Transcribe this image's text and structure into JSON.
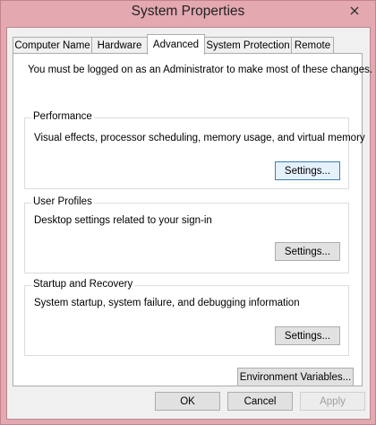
{
  "window": {
    "title": "System Properties"
  },
  "tabs": [
    {
      "label": "Computer Name"
    },
    {
      "label": "Hardware"
    },
    {
      "label": "Advanced"
    },
    {
      "label": "System Protection"
    },
    {
      "label": "Remote"
    }
  ],
  "active_tab": "Advanced",
  "notice": "You must be logged on as an Administrator to make most of these changes.",
  "groups": {
    "performance": {
      "title": "Performance",
      "description": "Visual effects, processor scheduling, memory usage, and virtual memory",
      "button": "Settings..."
    },
    "user_profiles": {
      "title": "User Profiles",
      "description": "Desktop settings related to your sign-in",
      "button": "Settings..."
    },
    "startup_recovery": {
      "title": "Startup and Recovery",
      "description": "System startup, system failure, and debugging information",
      "button": "Settings..."
    }
  },
  "environment_button": "Environment Variables...",
  "footer": {
    "ok": "OK",
    "cancel": "Cancel",
    "apply": "Apply"
  },
  "icons": {
    "close": "close-icon"
  },
  "colors": {
    "window_frame": "#e2a5ad",
    "focus_border": "#3c7fb1"
  }
}
